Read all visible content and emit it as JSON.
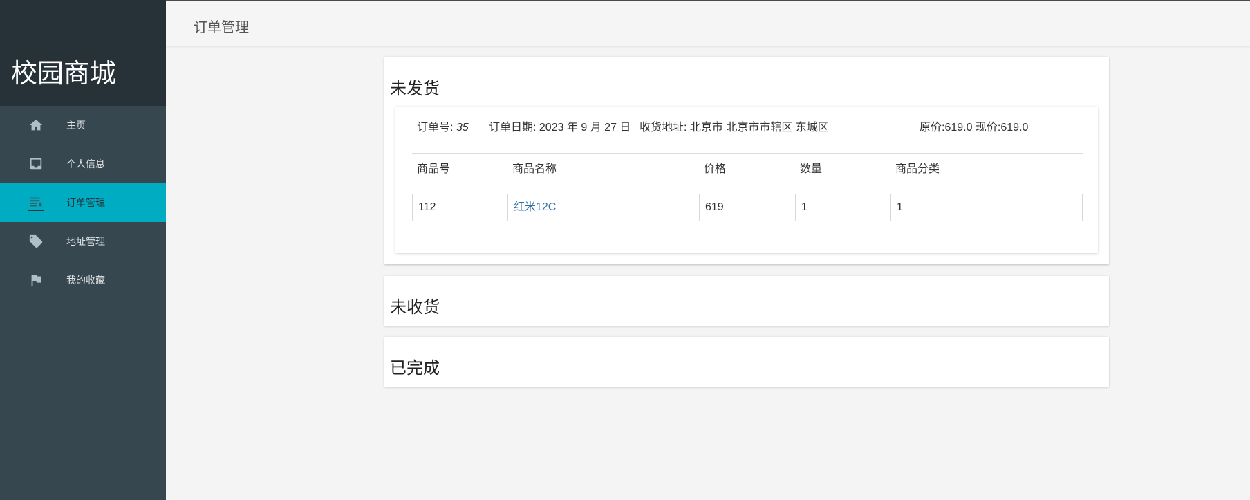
{
  "app": {
    "title": "校园商城"
  },
  "sidebar": {
    "items": [
      {
        "label": "主页",
        "icon": "home-icon"
      },
      {
        "label": "个人信息",
        "icon": "inbox-icon"
      },
      {
        "label": "订单管理",
        "icon": "orders-icon",
        "active": true
      },
      {
        "label": "地址管理",
        "icon": "tag-icon"
      },
      {
        "label": "我的收藏",
        "icon": "flag-icon"
      }
    ]
  },
  "header": {
    "title": "订单管理"
  },
  "sections": {
    "unshipped": {
      "title": "未发货",
      "order": {
        "number_label": "订单号:",
        "number": "35",
        "date": "订单日期: 2023 年 9 月 27 日",
        "address": "收货地址: 北京市 北京市市辖区 东城区",
        "price": "原价:619.0 现价:619.0",
        "columns": [
          "商品号",
          "商品名称",
          "价格",
          "数量",
          "商品分类"
        ],
        "rows": [
          {
            "id": "112",
            "name": "红米12C",
            "price": "619",
            "quantity": "1",
            "category": "1"
          }
        ]
      }
    },
    "unreceived": {
      "title": "未收货"
    },
    "completed": {
      "title": "已完成"
    }
  },
  "colors": {
    "sidebar": "#36474f",
    "brand_bg": "#263238",
    "active": "#00acc1",
    "link": "#2f6faa"
  }
}
